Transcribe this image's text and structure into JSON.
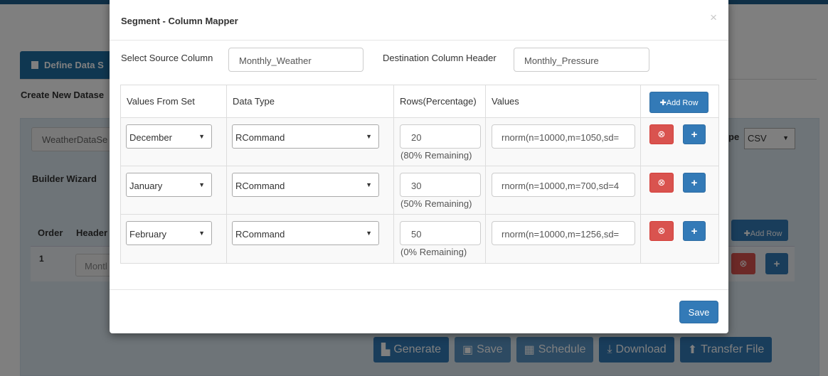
{
  "background": {
    "tab_label": "Define Data S",
    "create_new_label": "Create New Datase",
    "dataset_input_value": "WeatherDataSe",
    "file_type_label": "pe",
    "file_type_value": "CSV",
    "builder_wizard_label": "Builder Wizard",
    "order_header": "Order",
    "header_header": "Header",
    "row_order": "1",
    "row_header_value": "Montl",
    "add_row_label": "Add Row",
    "actions": {
      "generate": "Generate",
      "save": "Save",
      "schedule": "Schedule",
      "download": "Download",
      "transfer_file": "Transfer File"
    }
  },
  "modal": {
    "title": "Segment - Column Mapper",
    "close_symbol": "×",
    "source_label": "Select Source Column",
    "source_value": "Monthly_Weather",
    "destination_label": "Destination Column Header",
    "destination_value": "Monthly_Pressure",
    "table": {
      "headers": {
        "values_from_set": "Values From Set",
        "data_type": "Data Type",
        "rows_percentage": "Rows(Percentage)",
        "values": "Values",
        "add_row": "Add Row"
      },
      "rows": [
        {
          "set_value": "December",
          "data_type": "RCommand",
          "percentage": "20",
          "remaining": "(80% Remaining)",
          "value": "rnorm(n=10000,m=1050,sd="
        },
        {
          "set_value": "January",
          "data_type": "RCommand",
          "percentage": "30",
          "remaining": "(50% Remaining)",
          "value": "rnorm(n=10000,m=700,sd=4"
        },
        {
          "set_value": "February",
          "data_type": "RCommand",
          "percentage": "50",
          "remaining": "(0% Remaining)",
          "value": "rnorm(n=10000,m=1256,sd="
        }
      ]
    },
    "save_label": "Save"
  },
  "colors": {
    "primary": "#337ab7",
    "danger": "#d9534f",
    "overlay": "rgba(0,0,0,0.5)"
  }
}
